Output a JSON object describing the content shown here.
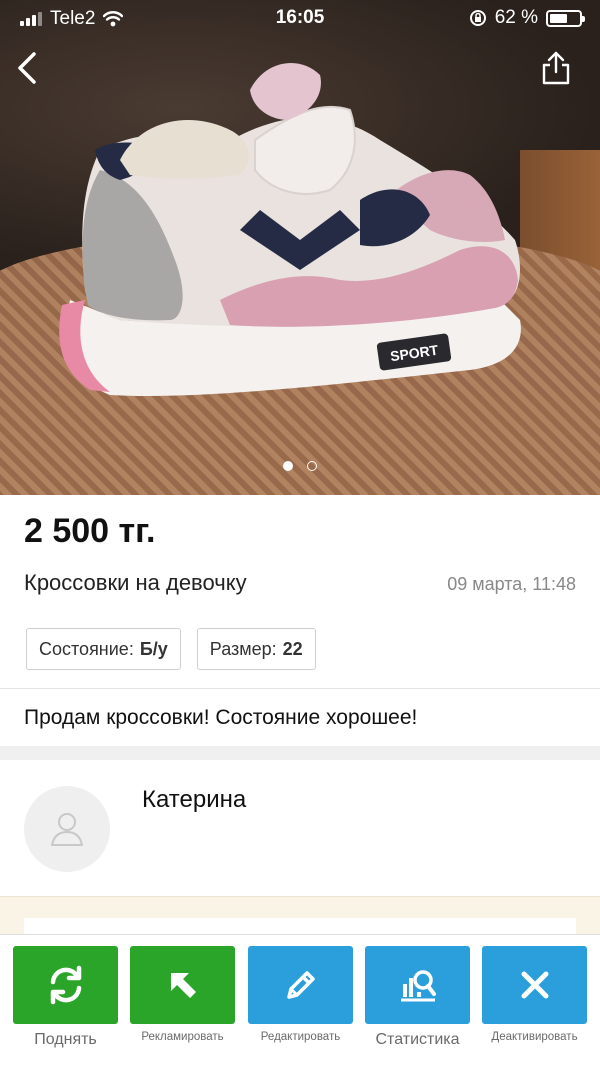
{
  "status_bar": {
    "carrier": "Tele2",
    "time": "16:05",
    "battery_percent": "62 %",
    "battery_level": 0.62
  },
  "header": {
    "back_icon": "chevron-left-icon",
    "share_icon": "share-icon"
  },
  "gallery": {
    "total_images": 2,
    "active_index": 0
  },
  "listing": {
    "price": "2 500 тг.",
    "title": "Кроссовки на девочку",
    "date": "09 марта, 11:48",
    "condition_label": "Состояние:",
    "condition_value": "Б/у",
    "size_label": "Размер:",
    "size_value": "22",
    "description": "Продам кроссовки! Состояние хорошее!"
  },
  "seller": {
    "name": "Катерина"
  },
  "toolbar": {
    "items": [
      {
        "label": "Поднять",
        "icon": "refresh-icon",
        "color": "#2aa529"
      },
      {
        "label": "Рекламировать",
        "icon": "arrow-up-left-icon",
        "color": "#2aa529"
      },
      {
        "label": "Редактировать",
        "icon": "pencil-icon",
        "color": "#2b9fdb"
      },
      {
        "label": "Статистика",
        "icon": "stats-icon",
        "color": "#2b9fdb"
      },
      {
        "label": "Деактивировать",
        "icon": "close-icon",
        "color": "#2b9fdb"
      }
    ]
  }
}
